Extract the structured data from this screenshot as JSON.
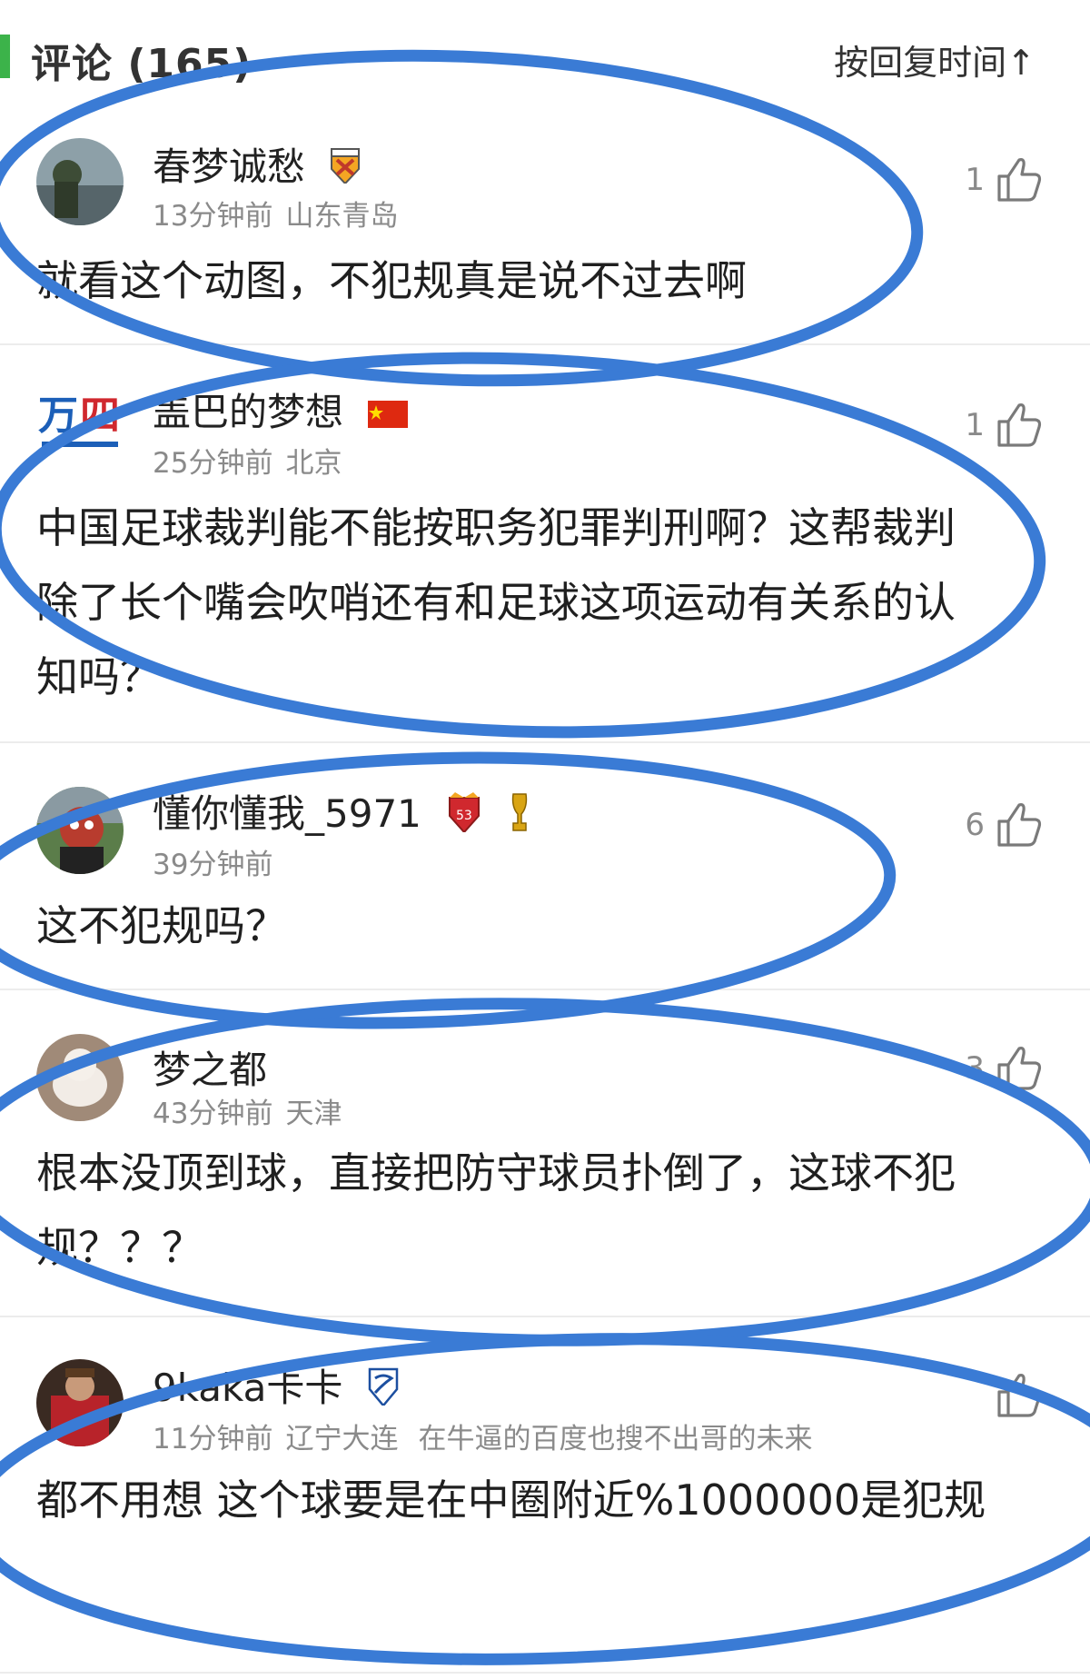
{
  "header": {
    "title": "评论 (165)",
    "sort_label": "按回复时间↑"
  },
  "comments": [
    {
      "username": "春梦诚愁",
      "time": "13分钟前",
      "location": "山东青岛",
      "text": "就看这个动图，不犯规真是说不过去啊",
      "likes": "1"
    },
    {
      "username": "盖巴的梦想",
      "time": "25分钟前",
      "location": "北京",
      "text": "中国足球裁判能不能按职务犯罪判刑啊？这帮裁判除了长个嘴会吹哨还有和足球这项运动有关系的认知吗？",
      "likes": "1"
    },
    {
      "username": "懂你懂我_5971",
      "time": "39分钟前",
      "location": "",
      "text": "这不犯规吗？",
      "likes": "6"
    },
    {
      "username": "梦之都",
      "time": "43分钟前",
      "location": "天津",
      "text": "根本没顶到球，直接把防守球员扑倒了，这球不犯规？？？",
      "likes": "3"
    },
    {
      "username": "9kaka卡卡",
      "time": "11分钟前",
      "location": "辽宁大连",
      "signature": "在牛逼的百度也搜不出哥的未来",
      "text": "都不用想 这个球要是在中圈附近%1000000是犯规",
      "likes": ""
    }
  ],
  "colors": {
    "accent_bar": "#3cb34a",
    "highlight_ellipse": "#3a7bd5",
    "meta_text": "#8a8a8a"
  },
  "icons": [
    "thumbs-up-icon",
    "team-badge-icon",
    "flag-icon",
    "trophy-icon"
  ]
}
